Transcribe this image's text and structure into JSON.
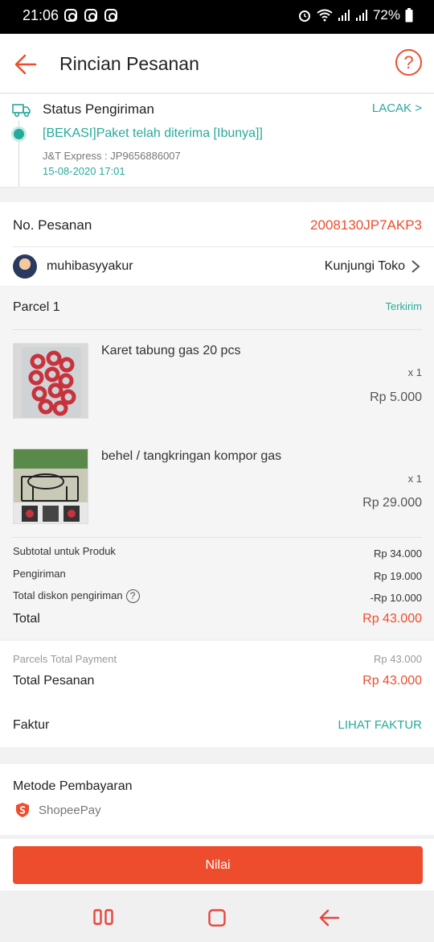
{
  "status_bar": {
    "time": "21:06",
    "battery": "72%"
  },
  "header": {
    "title": "Rincian Pesanan"
  },
  "shipping": {
    "title": "Status Pengiriman",
    "track_label": "LACAK >",
    "message": "[BEKASI]Paket telah diterima [Ibunya]]",
    "courier": "J&T Express :  JP9656886007",
    "timestamp": "15-08-2020 17:01"
  },
  "order": {
    "label": "No. Pesanan",
    "number": "2008130JP7AKP3",
    "shop_name": "muhibasyyakur",
    "visit_label": "Kunjungi Toko"
  },
  "parcel": {
    "title": "Parcel 1",
    "status": "Terkirim",
    "items": [
      {
        "name": "Karet tabung gas 20 pcs",
        "qty": "x 1",
        "price": "Rp 5.000"
      },
      {
        "name": "behel / tangkringan kompor gas",
        "qty": "x 1",
        "price": "Rp 29.000"
      }
    ]
  },
  "summary": {
    "subtotal_label": "Subtotal untuk Produk",
    "subtotal_value": "Rp 34.000",
    "shipping_label": "Pengiriman",
    "shipping_value": "Rp 19.000",
    "discount_label": "Total diskon pengiriman",
    "discount_value": "-Rp 10.000",
    "total_label": "Total",
    "total_value": "Rp 43.000"
  },
  "payment": {
    "parcels_label": "Parcels Total Payment",
    "parcels_value": "Rp 43.000",
    "total_label": "Total Pesanan",
    "total_value": "Rp 43.000",
    "invoice_label": "Faktur",
    "invoice_link": "LIHAT FAKTUR"
  },
  "method": {
    "title": "Metode Pembayaran",
    "name": "ShopeePay"
  },
  "action": {
    "button_label": "Nilai"
  },
  "colors": {
    "brand": "#ee4d2d",
    "teal": "#26aa99"
  }
}
